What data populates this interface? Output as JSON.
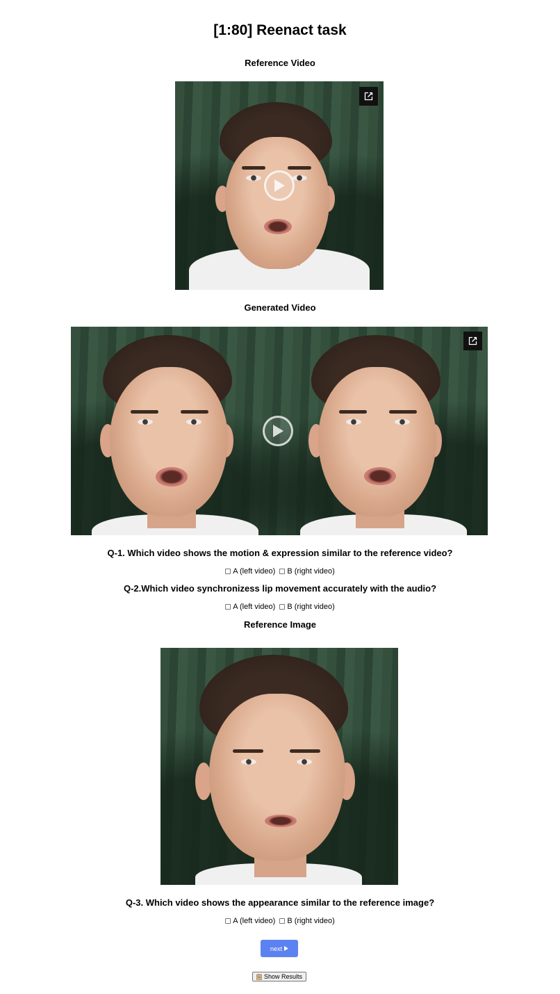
{
  "page": {
    "title": "[1:80] Reenact task"
  },
  "reference_video": {
    "label": "Reference Video"
  },
  "generated_video": {
    "label": "Generated Video"
  },
  "questions": [
    {
      "text": "Q-1. Which video shows the motion & expression similar to the reference video?",
      "options": [
        "A (left video)",
        "B (right video)"
      ],
      "checked": [
        false,
        false
      ]
    },
    {
      "text": "Q-2.Which video synchronizess lip movement accurately with the audio?",
      "options": [
        "A (left video)",
        "B (right video)"
      ],
      "checked": [
        false,
        false
      ]
    },
    {
      "text": "Q-3. Which video shows the appearance similar to the reference image?",
      "options": [
        "A (left video)",
        "B (right video)"
      ],
      "checked": [
        false,
        false
      ]
    }
  ],
  "reference_image": {
    "label": "Reference Image"
  },
  "buttons": {
    "next_label": "next",
    "next_icon": "play-triangle-icon",
    "show_results_label": "Show Results",
    "show_results_icon": "clipboard-icon",
    "next_color": "#5b82f0"
  },
  "icons": {
    "popout": "open-in-new-window-icon",
    "play": "play-circle-icon"
  }
}
